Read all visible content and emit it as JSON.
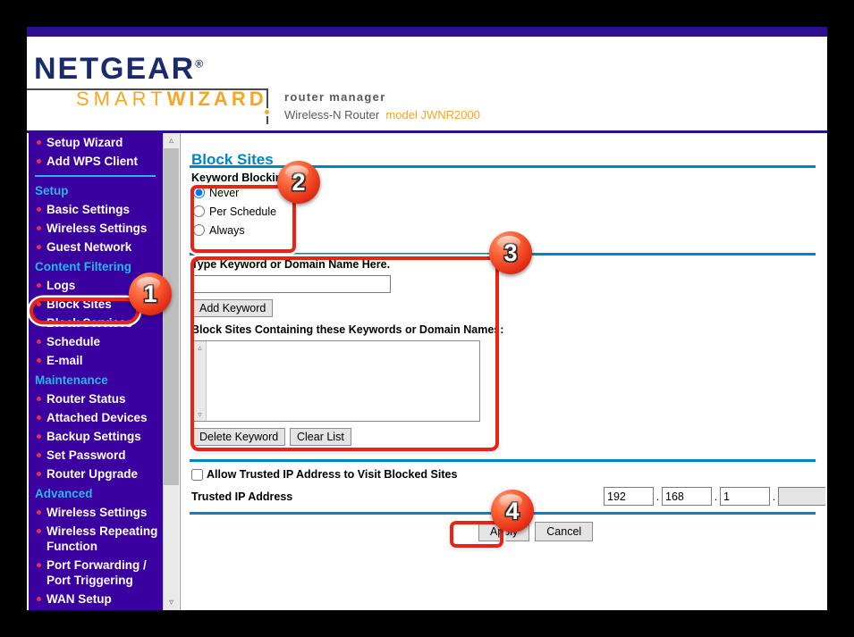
{
  "header": {
    "brand": "NETGEAR",
    "brand_reg": "®",
    "wizard_smart": "SMART",
    "wizard_bold": "WIZARD",
    "router_manager": "router manager",
    "device": "Wireless-N Router",
    "model": "model JWNR2000"
  },
  "colors": {
    "sidebar_bg": "#3a00a0",
    "top_strip": "#2d0e8f",
    "accent_blue": "#0086c8",
    "section_head": "#29b6e8",
    "bullet_red": "#e8304a",
    "brand_navy": "#1b2a6b",
    "brand_orange": "#f5a623",
    "highlight_red": "#f02014"
  },
  "sidebar": {
    "items": [
      {
        "type": "link",
        "label": "Setup Wizard"
      },
      {
        "type": "link",
        "label": "Add WPS Client"
      },
      {
        "type": "sep"
      },
      {
        "type": "heading",
        "label": "Setup"
      },
      {
        "type": "link",
        "label": "Basic Settings"
      },
      {
        "type": "link",
        "label": "Wireless Settings"
      },
      {
        "type": "link",
        "label": "Guest Network"
      },
      {
        "type": "heading",
        "label": "Content Filtering"
      },
      {
        "type": "link",
        "label": "Logs"
      },
      {
        "type": "link",
        "label": "Block Sites",
        "selected": true
      },
      {
        "type": "link",
        "label": "Block Services"
      },
      {
        "type": "link",
        "label": "Schedule"
      },
      {
        "type": "link",
        "label": "E-mail"
      },
      {
        "type": "heading",
        "label": "Maintenance"
      },
      {
        "type": "link",
        "label": "Router Status"
      },
      {
        "type": "link",
        "label": "Attached Devices"
      },
      {
        "type": "link",
        "label": "Backup Settings"
      },
      {
        "type": "link",
        "label": "Set Password"
      },
      {
        "type": "link",
        "label": "Router Upgrade"
      },
      {
        "type": "heading",
        "label": "Advanced"
      },
      {
        "type": "link",
        "label": "Wireless Settings"
      },
      {
        "type": "link",
        "label": "Wireless Repeating Function"
      },
      {
        "type": "link",
        "label": "Port Forwarding / Port Triggering"
      },
      {
        "type": "link",
        "label": "WAN Setup"
      }
    ],
    "scroll_up_icon": "chevron-up-icon",
    "scroll_down_icon": "chevron-down-icon"
  },
  "main": {
    "title": "Block Sites",
    "keyword_blocking_label": "Keyword Blocking",
    "radio_options": [
      {
        "label": "Never",
        "checked": true
      },
      {
        "label": "Per Schedule",
        "checked": false
      },
      {
        "label": "Always",
        "checked": false
      }
    ],
    "keyword_prompt": "Type Keyword or Domain Name Here.",
    "keyword_value": "",
    "add_keyword_label": "Add Keyword",
    "block_list_label": "Block Sites Containing these Keywords or Domain Names:",
    "block_list_items": [],
    "delete_keyword_label": "Delete Keyword",
    "clear_list_label": "Clear List",
    "allow_trusted_label": "Allow Trusted IP Address to Visit Blocked Sites",
    "allow_trusted_checked": false,
    "trusted_ip_label": "Trusted IP Address",
    "trusted_ip": {
      "octet1": "192",
      "octet2": "168",
      "octet3": "1",
      "octet4": "",
      "octet4_disabled": true,
      "separator": "."
    },
    "apply_label": "Apply",
    "cancel_label": "Cancel"
  },
  "annotations": {
    "badges": [
      {
        "number": "1",
        "target": "sidebar-item-block-sites"
      },
      {
        "number": "2",
        "target": "keyword-blocking-radio-group"
      },
      {
        "number": "3",
        "target": "keyword-panel"
      },
      {
        "number": "4",
        "target": "apply-button"
      }
    ]
  }
}
